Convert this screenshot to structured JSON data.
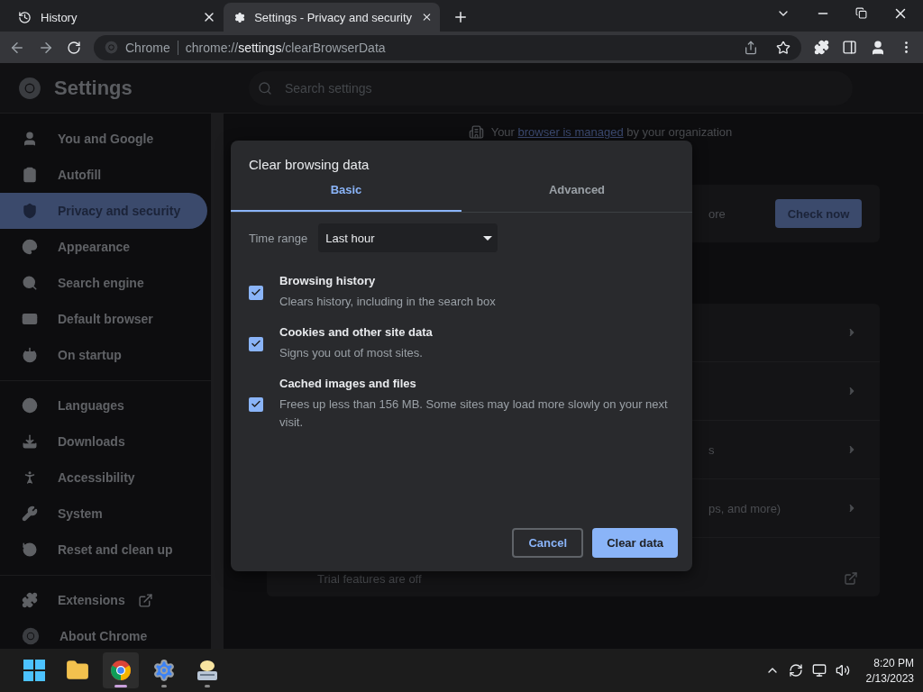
{
  "browser_tabs": [
    {
      "title": "History",
      "selected": false
    },
    {
      "title": "Settings - Privacy and security",
      "selected": true
    }
  ],
  "toolbar": {
    "site_label": "Chrome",
    "url_prefix": "chrome://",
    "url_bold": "settings",
    "url_rest": "/clearBrowserData"
  },
  "settings_header": {
    "title": "Settings",
    "search_placeholder": "Search settings"
  },
  "sidebar": {
    "groups": [
      {
        "items": [
          {
            "label": "You and Google",
            "selected": false,
            "kind": "page"
          },
          {
            "label": "Autofill",
            "selected": false,
            "kind": "page"
          },
          {
            "label": "Privacy and security",
            "selected": true,
            "kind": "page"
          },
          {
            "label": "Appearance",
            "selected": false,
            "kind": "page"
          },
          {
            "label": "Search engine",
            "selected": false,
            "kind": "page"
          },
          {
            "label": "Default browser",
            "selected": false,
            "kind": "page"
          },
          {
            "label": "On startup",
            "selected": false,
            "kind": "page"
          }
        ]
      },
      {
        "items": [
          {
            "label": "Languages",
            "selected": false,
            "kind": "page"
          },
          {
            "label": "Downloads",
            "selected": false,
            "kind": "page"
          },
          {
            "label": "Accessibility",
            "selected": false,
            "kind": "page"
          },
          {
            "label": "System",
            "selected": false,
            "kind": "page"
          },
          {
            "label": "Reset and clean up",
            "selected": false,
            "kind": "page"
          }
        ]
      },
      {
        "items": [
          {
            "label": "Extensions",
            "selected": false,
            "kind": "external"
          },
          {
            "label": "About Chrome",
            "selected": false,
            "kind": "page"
          }
        ]
      }
    ]
  },
  "managed_notice": {
    "before": "Your",
    "link": "browser is managed",
    "after": "by your organization"
  },
  "background": {
    "check_fragment": "ore",
    "check_button": "Check now",
    "rows": [
      {
        "text": "",
        "kind": "chevron"
      },
      {
        "text": "",
        "kind": "chevron"
      },
      {
        "text": "s",
        "kind": "chevron"
      },
      {
        "text": "ps, and more)",
        "kind": "chevron"
      },
      {
        "text": "Trial features are off",
        "kind": "external"
      }
    ]
  },
  "dialog": {
    "title": "Clear browsing data",
    "tabs": [
      {
        "label": "Basic",
        "selected": true
      },
      {
        "label": "Advanced",
        "selected": false
      }
    ],
    "time_range": {
      "label": "Time range",
      "value": "Last hour"
    },
    "options": [
      {
        "title": "Browsing history",
        "description": "Clears history, including in the search box",
        "checked": true
      },
      {
        "title": "Cookies and other site data",
        "description": "Signs you out of most sites.",
        "checked": true
      },
      {
        "title": "Cached images and files",
        "description": "Frees up less than 156 MB. Some sites may load more slowly on your next visit.",
        "checked": true
      }
    ],
    "buttons": [
      {
        "label": "Cancel",
        "kind": "secondary"
      },
      {
        "label": "Clear data",
        "kind": "primary"
      }
    ]
  },
  "taskbar": {
    "apps": [
      {
        "kind": "start",
        "running": false,
        "selected": false
      },
      {
        "kind": "folder",
        "running": false,
        "selected": false
      },
      {
        "kind": "chrome",
        "running": true,
        "selected": true
      },
      {
        "kind": "settings",
        "running": true,
        "selected": false
      },
      {
        "kind": "keyboard",
        "running": true,
        "selected": false
      }
    ],
    "time": "8:20 PM",
    "date": "2/13/2023"
  }
}
